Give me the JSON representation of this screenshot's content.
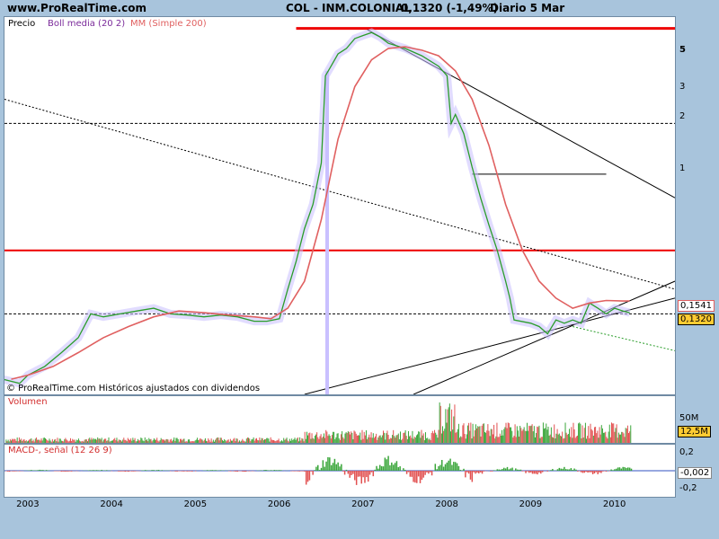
{
  "header": {
    "site": "www.ProRealTime.com",
    "instrument": "COL - INM.COLONIAL",
    "quote": "0,1320 (-1,49%)",
    "period": "Diario  5 Mar"
  },
  "legend": {
    "price": "Precio",
    "boll": "Boll media (20 2)",
    "ma": "MM (Simple 200)",
    "copyright": "© ProRealTime.com  Históricos ajustados con dividendos"
  },
  "volume_panel": {
    "title": "Volumen",
    "tick": "50M",
    "last": "12,5M"
  },
  "macd_panel": {
    "title": "MACD-, señal (12 26 9)",
    "ticks": [
      "0,2",
      "-0,2"
    ],
    "last": "-0,002"
  },
  "price_axis": {
    "ticks": [
      "5",
      "3",
      "2",
      "1"
    ],
    "ma_last": "0,1541",
    "close_last": "0,1320"
  },
  "colors": {
    "background": "#a8c4dc",
    "price_up": "#2a9d2a",
    "price_down": "#d33030",
    "bollinger": "#c9c0ff",
    "ma": "#e06060",
    "resistance": "#ee0000",
    "volume_up": "#3aa63a",
    "volume_down": "#e25050"
  },
  "chart_data": {
    "type": "line",
    "title": "COL - INM.COLONIAL",
    "x_ticks": [
      "2003",
      "2004",
      "2005",
      "2006",
      "2007",
      "2008",
      "2009",
      "2010"
    ],
    "y_scale": "log",
    "ylim": [
      0.045,
      6.5
    ],
    "series": [
      {
        "name": "Precio",
        "x": [
          2002.7,
          2002.9,
          2003.0,
          2003.2,
          2003.4,
          2003.6,
          2003.75,
          2003.9,
          2004.1,
          2004.3,
          2004.5,
          2004.7,
          2004.9,
          2005.1,
          2005.3,
          2005.5,
          2005.7,
          2005.85,
          2006.0,
          2006.1,
          2006.2,
          2006.3,
          2006.4,
          2006.5,
          2006.55,
          2006.6,
          2006.7,
          2006.8,
          2006.9,
          2007.0,
          2007.1,
          2007.2,
          2007.3,
          2007.5,
          2007.7,
          2007.9,
          2008.0,
          2008.05,
          2008.1,
          2008.2,
          2008.3,
          2008.4,
          2008.5,
          2008.6,
          2008.7,
          2008.75,
          2008.8,
          2009.0,
          2009.1,
          2009.2,
          2009.3,
          2009.4,
          2009.5,
          2009.6,
          2009.7,
          2009.8,
          2009.9,
          2010.0,
          2010.1,
          2010.18
        ],
        "values": [
          0.055,
          0.052,
          0.058,
          0.065,
          0.078,
          0.095,
          0.13,
          0.125,
          0.13,
          0.135,
          0.14,
          0.13,
          0.128,
          0.125,
          0.128,
          0.125,
          0.118,
          0.118,
          0.122,
          0.18,
          0.26,
          0.4,
          0.55,
          0.95,
          3.0,
          3.3,
          4.0,
          4.3,
          4.9,
          5.1,
          5.3,
          5.0,
          4.6,
          4.3,
          3.9,
          3.4,
          3.0,
          1.6,
          1.8,
          1.4,
          0.9,
          0.6,
          0.42,
          0.3,
          0.2,
          0.16,
          0.12,
          0.115,
          0.11,
          0.1,
          0.12,
          0.115,
          0.12,
          0.115,
          0.15,
          0.14,
          0.13,
          0.14,
          0.135,
          0.132
        ]
      },
      {
        "name": "MM (Simple 200)",
        "x": [
          2002.8,
          2003.0,
          2003.3,
          2003.6,
          2003.9,
          2004.2,
          2004.5,
          2004.8,
          2005.1,
          2005.4,
          2005.7,
          2005.9,
          2006.1,
          2006.3,
          2006.5,
          2006.7,
          2006.9,
          2007.1,
          2007.3,
          2007.5,
          2007.7,
          2007.9,
          2008.1,
          2008.3,
          2008.5,
          2008.7,
          2008.9,
          2009.1,
          2009.3,
          2009.5,
          2009.7,
          2009.9,
          2010.1,
          2010.18
        ],
        "values": [
          0.055,
          0.058,
          0.065,
          0.078,
          0.095,
          0.11,
          0.125,
          0.135,
          0.132,
          0.128,
          0.125,
          0.122,
          0.14,
          0.2,
          0.45,
          1.3,
          2.6,
          3.7,
          4.3,
          4.4,
          4.2,
          3.9,
          3.2,
          2.2,
          1.2,
          0.55,
          0.3,
          0.2,
          0.16,
          0.14,
          0.15,
          0.155,
          0.154,
          0.1541
        ]
      }
    ],
    "volume": {
      "title": "Volumen",
      "ylim": [
        0,
        75
      ]
    },
    "macd": {
      "title": "MACD-, señal (12 26 9)",
      "ylim": [
        -0.3,
        0.3
      ]
    }
  }
}
